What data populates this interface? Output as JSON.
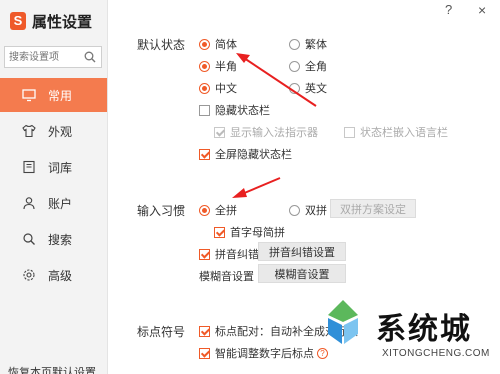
{
  "app": {
    "title": "属性设置",
    "logo_letter": "S"
  },
  "window": {
    "help": "?",
    "close": "×"
  },
  "search": {
    "placeholder": "搜索设置项"
  },
  "sidebar": {
    "items": [
      {
        "label": "常用",
        "icon": "monitor-icon",
        "active": true
      },
      {
        "label": "外观",
        "icon": "shirt-icon",
        "active": false
      },
      {
        "label": "词库",
        "icon": "book-icon",
        "active": false
      },
      {
        "label": "账户",
        "icon": "user-icon",
        "active": false
      },
      {
        "label": "搜索",
        "icon": "search-icon",
        "active": false
      },
      {
        "label": "高级",
        "icon": "gear-icon",
        "active": false
      }
    ],
    "restore_label": "恢复本页默认设置"
  },
  "default_state": {
    "label": "默认状态",
    "simplified": "简体",
    "traditional": "繁体",
    "half_width": "半角",
    "full_width": "全角",
    "chinese": "中文",
    "english": "英文",
    "hide_statusbar": "隐藏状态栏",
    "show_indicator": "显示输入法指示器",
    "embed_statusbar": "状态栏嵌入语言栏",
    "fullscreen_hide": "全屏隐藏状态栏"
  },
  "input_habit": {
    "label": "输入习惯",
    "full_pinyin": "全拼",
    "double_pinyin": "双拼",
    "double_scheme_button": "双拼方案设定",
    "initial_abbrev": "首字母简拼",
    "pinyin_correct": "拼音纠错",
    "pinyin_correct_button": "拼音纠错设置",
    "fuzzy_label": "模糊音设置",
    "fuzzy_button": "模糊音设置"
  },
  "punctuation": {
    "label": "标点符号",
    "pairing": "标点配对：自动补全成对标点",
    "smart_adjust": "智能调整数字后标点"
  },
  "watermark": {
    "title": "系统城",
    "sub": "XITONGCHENG.COM"
  },
  "colors": {
    "accent": "#f05a28",
    "nav_active": "#f47b4e"
  }
}
